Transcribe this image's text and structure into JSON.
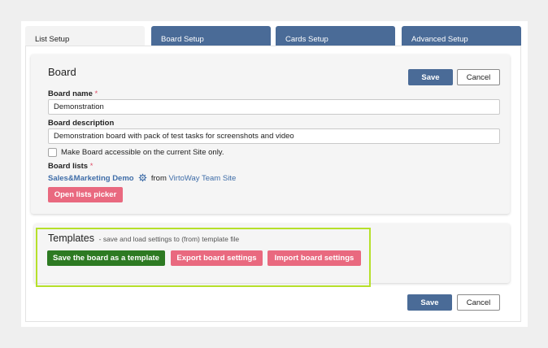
{
  "tabs": [
    "List Setup",
    "Board Setup",
    "Cards Setup",
    "Advanced Setup"
  ],
  "board": {
    "title": "Board",
    "save_label": "Save",
    "cancel_label": "Cancel",
    "name_label": "Board name",
    "required_mark": "*",
    "name_value": "Demonstration",
    "description_label": "Board description",
    "description_value": "Demonstration board with pack of test tasks for screenshots and video",
    "site_only_label": "Make Board accessible on the current Site only.",
    "lists_label": "Board lists",
    "list_name": "Sales&Marketing Demo",
    "from_text": "from",
    "site_name": "VirtoWay Team Site",
    "picker_label": "Open lists picker"
  },
  "templates": {
    "title": "Templates",
    "subtitle": "- save and load settings to (from) template file",
    "save_template_label": "Save the board as a template",
    "export_label": "Export board settings",
    "import_label": "Import board settings"
  },
  "footer": {
    "save_label": "Save",
    "cancel_label": "Cancel"
  },
  "colors": {
    "primary": "#4a6b97",
    "pink": "#e9697f",
    "green": "#2d7a22",
    "highlight": "#b6e02b",
    "link": "#3f6da8"
  },
  "icons": [
    "gear-icon"
  ]
}
